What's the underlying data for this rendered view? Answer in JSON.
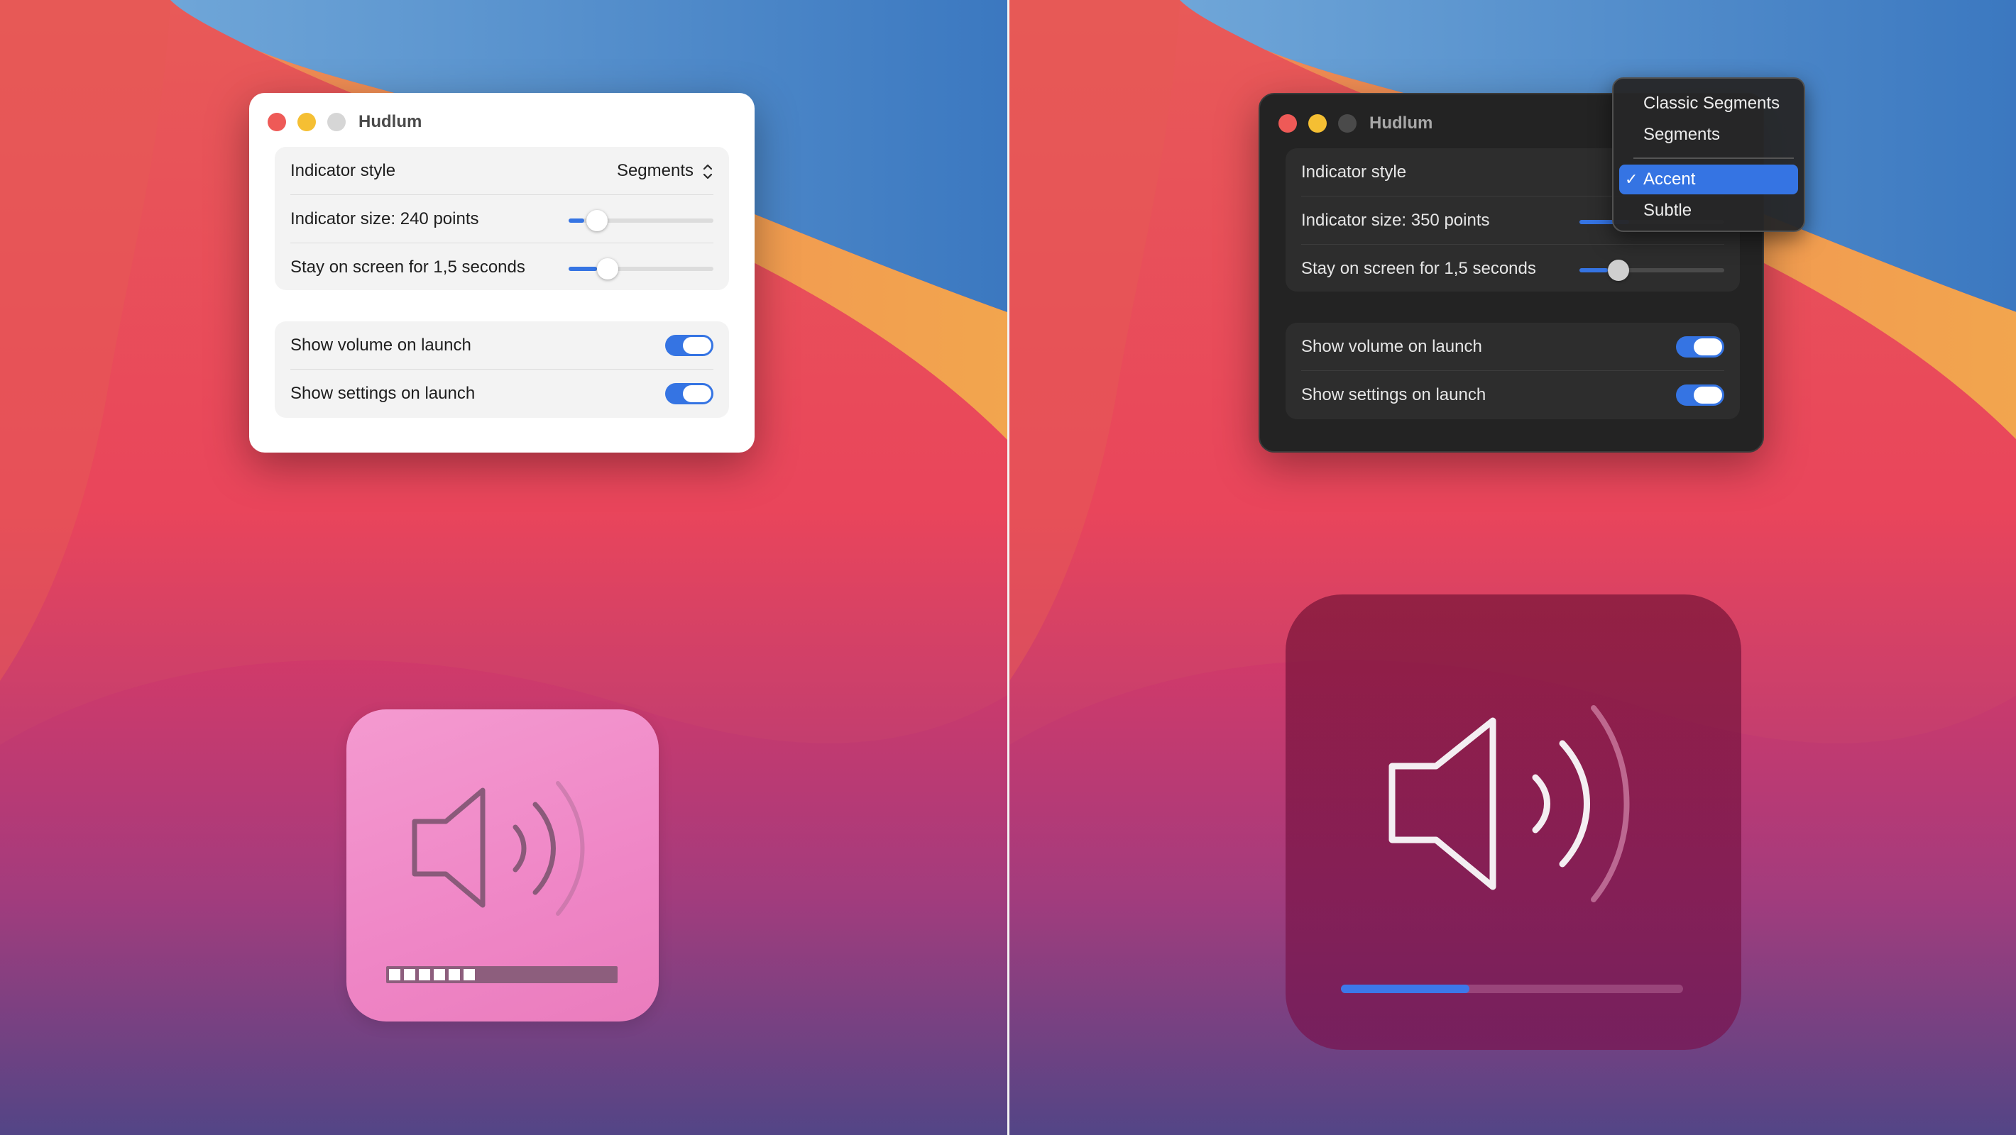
{
  "colors": {
    "accent": "#3574e3",
    "close": "#ee5a57",
    "minimize": "#f5bf33"
  },
  "left_window": {
    "title": "Hudlum",
    "indicator_style": {
      "label": "Indicator style",
      "value": "Segments"
    },
    "indicator_size": {
      "label": "Indicator size: 240 points",
      "slider_value": 0.2
    },
    "stay_on_screen": {
      "label": "Stay on screen for 1,5 seconds",
      "slider_value": 0.27
    },
    "show_volume": {
      "label": "Show volume on launch",
      "on": true
    },
    "show_settings": {
      "label": "Show settings on launch",
      "on": true
    }
  },
  "right_window": {
    "title": "Hudlum",
    "indicator_style": {
      "label": "Indicator style"
    },
    "indicator_size": {
      "label": "Indicator size: 350 points"
    },
    "stay_on_screen": {
      "label": "Stay on screen for 1,5 seconds",
      "slider_value": 0.27
    },
    "show_volume": {
      "label": "Show volume on launch",
      "on": true
    },
    "show_settings": {
      "label": "Show settings on launch",
      "on": true
    }
  },
  "style_menu": {
    "items": [
      "Classic Segments",
      "Segments",
      "Accent",
      "Subtle"
    ],
    "selected": "Accent",
    "check": "✓"
  },
  "hud_left": {
    "style": "segments",
    "icon": "speaker-icon",
    "segments_filled": 6
  },
  "hud_right": {
    "style": "accent",
    "icon": "speaker-icon",
    "level": 0.375
  }
}
